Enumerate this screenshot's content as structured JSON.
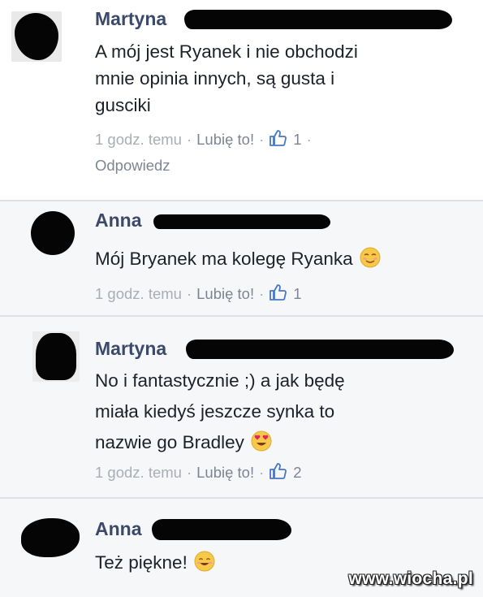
{
  "comments": [
    {
      "author": "Martyna",
      "text_lines": [
        "A mój jest Ryanek i nie obchodzi",
        "mnie opinia innych, są gusta i",
        "gusciki"
      ],
      "time": "1 godz. temu",
      "like_label": "Lubię to!",
      "like_count": "1",
      "reply_label": "Odpowiedz",
      "emoji": ""
    },
    {
      "author": "Anna",
      "text_lines": [
        "Mój Bryanek ma kolegę Ryanka"
      ],
      "time": "1 godz. temu",
      "like_label": "Lubię to!",
      "like_count": "1",
      "emoji": "relieved-emoji"
    },
    {
      "author": "Martyna",
      "text_lines": [
        "No i fantastycznie ;) a jak będę",
        "miała kiedyś jeszcze synka to",
        "nazwie go Bradley"
      ],
      "time": "1 godz. temu",
      "like_label": "Lubię to!",
      "like_count": "2",
      "emoji": "heart-eyes-emoji"
    },
    {
      "author": "Anna",
      "text_lines": [
        "Też piękne!"
      ],
      "emoji": "smiling-emoji"
    }
  ],
  "watermark": "www.wiocha.pl",
  "colors": {
    "name": "#3b4a6b",
    "text": "#1d2129",
    "meta": "#a9adb5",
    "reply_bg": "#f6f7f9",
    "divider": "#dfe1e6"
  }
}
